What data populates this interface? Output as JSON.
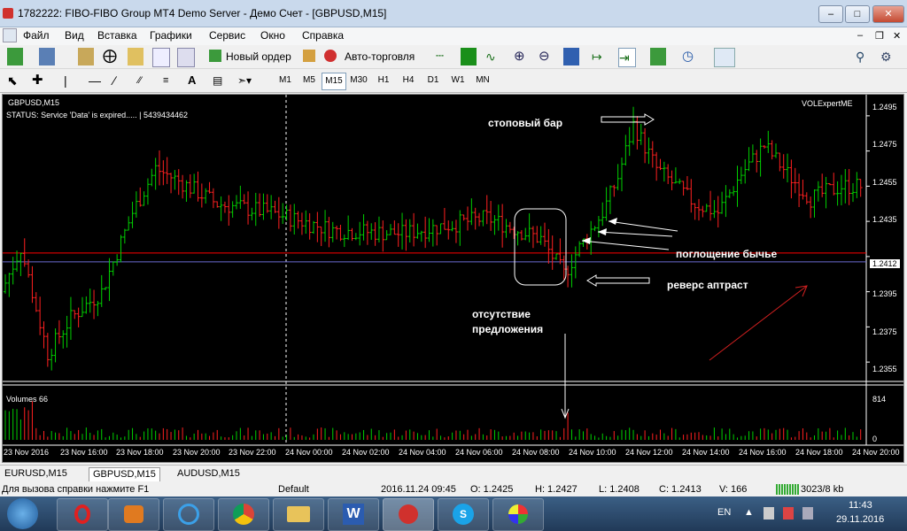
{
  "window": {
    "title": "1782222: FIBO-FIBO Group MT4 Demo Server - Демо Счет - [GBPUSD,M15]"
  },
  "menu": [
    "Файл",
    "Вид",
    "Вставка",
    "Графики",
    "Сервис",
    "Окно",
    "Справка"
  ],
  "toolbar": {
    "new_order": "Новый ордер",
    "autotrading": "Авто-торговля"
  },
  "timeframes": [
    "M1",
    "M5",
    "M15",
    "M30",
    "H1",
    "H4",
    "D1",
    "W1",
    "MN"
  ],
  "active_timeframe": "M15",
  "chart": {
    "symbol_label": "GBPUSD,M15",
    "status_line": "STATUS:  Service 'Data' is expired..... | 5439434462",
    "expert": "VOLExpertME",
    "volumes_label": "Volumes 66",
    "current_price": "1.2412",
    "price_ticks": [
      "1.2495",
      "1.2475",
      "1.2455",
      "1.2435",
      "1.2395",
      "1.2375",
      "1.2355"
    ],
    "volume_ticks": [
      "814",
      "0"
    ],
    "time_ticks": [
      "23 Nov 2016",
      "23 Nov 16:00",
      "23 Nov 18:00",
      "23 Nov 20:00",
      "23 Nov 22:00",
      "24 Nov 00:00",
      "24 Nov 02:00",
      "24 Nov 04:00",
      "24 Nov 06:00",
      "24 Nov 08:00",
      "24 Nov 10:00",
      "24 Nov 12:00",
      "24 Nov 14:00",
      "24 Nov 16:00",
      "24 Nov 18:00",
      "24 Nov 20:00"
    ],
    "annotations": {
      "stop_bar": "стоповый бар",
      "engulfing": "поглощение бычье",
      "reversal": "реверс аптраст",
      "no_supply": "отсутствие предложения"
    },
    "colors": {
      "bull": "#00d000",
      "bear": "#ff2020",
      "background": "#000000",
      "price_line": "#ff0000"
    }
  },
  "chart_data": {
    "type": "candlestick",
    "symbol": "GBPUSD",
    "ylim": [
      1.2345,
      1.2505
    ],
    "price_levels": [
      1.2412
    ],
    "seed_path": [
      [
        0,
        1.2395
      ],
      [
        5,
        1.242
      ],
      [
        12,
        1.236
      ],
      [
        18,
        1.238
      ],
      [
        26,
        1.2395
      ],
      [
        34,
        1.244
      ],
      [
        40,
        1.2465
      ],
      [
        46,
        1.2458
      ],
      [
        56,
        1.2445
      ],
      [
        70,
        1.244
      ],
      [
        86,
        1.243
      ],
      [
        104,
        1.2428
      ],
      [
        126,
        1.2437
      ],
      [
        140,
        1.2425
      ],
      [
        146,
        1.2405
      ],
      [
        150,
        1.242
      ],
      [
        156,
        1.244
      ],
      [
        160,
        1.246
      ],
      [
        164,
        1.249
      ],
      [
        170,
        1.2465
      ],
      [
        180,
        1.2445
      ],
      [
        186,
        1.244
      ],
      [
        192,
        1.2462
      ],
      [
        198,
        1.2478
      ],
      [
        204,
        1.2462
      ],
      [
        210,
        1.2448
      ],
      [
        218,
        1.2455
      ],
      [
        222,
        1.2455
      ]
    ],
    "volume_peak": 814
  },
  "tabs": [
    "EURUSD,M15",
    "GBPUSD,M15",
    "AUDUSD,M15"
  ],
  "active_tab": "GBPUSD,M15",
  "statusbar": {
    "help": "Для вызова справки нажмите F1",
    "profile": "Default",
    "datetime": "2016.11.24 09:45",
    "open": "O: 1.2425",
    "high": "H: 1.2427",
    "low": "L: 1.2408",
    "close": "C: 1.2413",
    "volume": "V: 166",
    "traffic": "3023/8 kb"
  },
  "taskbar": {
    "lang": "EN",
    "time": "11:43",
    "date": "29.11.2016"
  }
}
